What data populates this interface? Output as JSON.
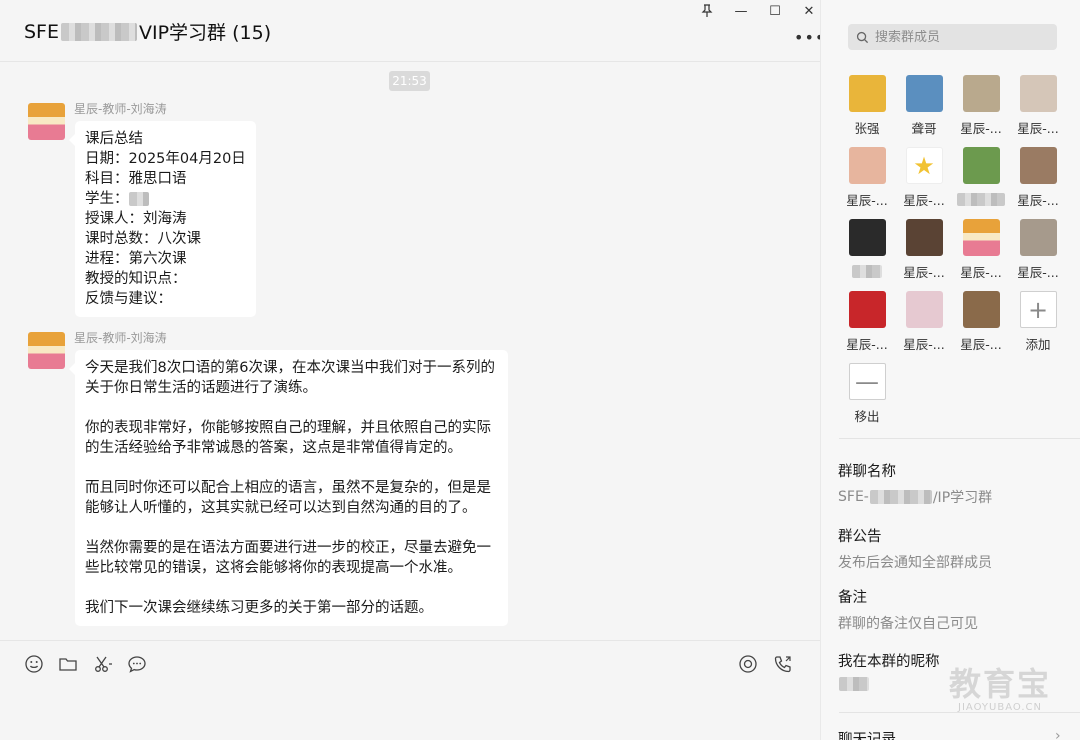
{
  "header": {
    "title_prefix": "SFE",
    "title_suffix": "VIP学习群 (15)",
    "pin_icon": "pin-icon",
    "more_label": "•••"
  },
  "window": {
    "minimize": "—",
    "maximize": "☐",
    "close": "✕"
  },
  "messages": {
    "timestamp": "21:53",
    "items": [
      {
        "sender": "星辰-教师-刘海涛",
        "lines": [
          "课后总结",
          "日期：2025年04月20日",
          "科目：雅思口语",
          "学生：",
          "授课人：刘海涛",
          "课时总数：八次课",
          "进程：第六次课",
          "教授的知识点：",
          "反馈与建议："
        ]
      },
      {
        "sender": "星辰-教师-刘海涛",
        "paragraphs": [
          "今天是我们8次口语的第6次课，在本次课当中我们对于一系列的关于你日常生活的话题进行了演练。",
          "你的表现非常好，你能够按照自己的理解，并且依照自己的实际的生活经验给予非常诚恳的答案，这点是非常值得肯定的。",
          "而且同时你还可以配合上相应的语言，虽然不是复杂的，但是是能够让人听懂的，这其实就已经可以达到自然沟通的目的了。",
          "当然你需要的是在语法方面要进行进一步的校正，尽量去避免一些比较常见的错误，这将会能够将你的表现提高一个水准。",
          "我们下一次课会继续练习更多的关于第一部分的话题。"
        ]
      }
    ]
  },
  "toolbar": {
    "icons": [
      "emoji-icon",
      "folder-icon",
      "scissors-icon",
      "chat-history-icon",
      "live-icon",
      "call-icon"
    ]
  },
  "panel": {
    "search_placeholder": "搜索群成员",
    "members": [
      {
        "name": "张强",
        "color": "#e9b53a"
      },
      {
        "name": "聋哥",
        "color": "#5b8fbf"
      },
      {
        "name": "星辰-...",
        "color": "#b9a98d"
      },
      {
        "name": "星辰-...",
        "color": "#d5c6b8"
      },
      {
        "name": "星辰-...",
        "color": "#e7b59e"
      },
      {
        "name": "星辰-...",
        "color": "#f1c232"
      },
      {
        "name": "",
        "color": "#6c9a4e"
      },
      {
        "name": "星辰-...",
        "color": "#9a7b63"
      },
      {
        "name": "",
        "color": "#2a2a2a"
      },
      {
        "name": "星辰-...",
        "color": "#5a4334"
      },
      {
        "name": "星辰-...",
        "color": "#e08a6a"
      },
      {
        "name": "星辰-...",
        "color": "#a69a8c"
      },
      {
        "name": "星辰-...",
        "color": "#c8262a"
      },
      {
        "name": "星辰-...",
        "color": "#e6c9d1"
      },
      {
        "name": "星辰-...",
        "color": "#8a6a4a"
      }
    ],
    "add_label": "添加",
    "add_symbol": "+",
    "remove_label": "移出",
    "remove_symbol": "—",
    "group_name_label": "群聊名称",
    "group_name_prefix": "SFE-",
    "group_name_suffix": "/IP学习群",
    "announcement_label": "群公告",
    "announcement_value": "发布后会通知全部群成员",
    "remark_label": "备注",
    "remark_value": "群聊的备注仅自己可见",
    "nickname_label": "我在本群的昵称",
    "history_label": "聊天记录"
  },
  "watermark": {
    "main": "教育宝",
    "sub": "JIAOYUBAO.CN"
  }
}
